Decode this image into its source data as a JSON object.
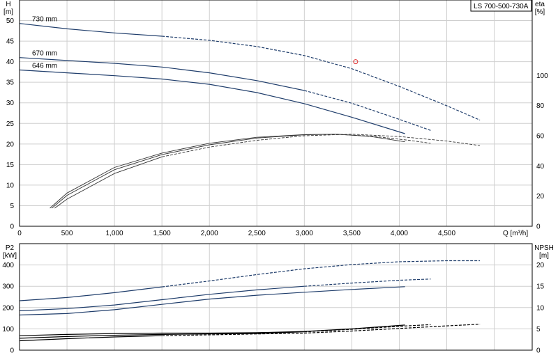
{
  "title": "LS 700-500-730A",
  "chart_data": [
    {
      "type": "line",
      "name": "upper",
      "ylabel_left": [
        "H",
        "[m]"
      ],
      "ylabel_right": [
        "eta",
        "[%]"
      ],
      "xlabel": "Q [m³/h]",
      "xlim": [
        0,
        5400
      ],
      "ylim_left": [
        0,
        55
      ],
      "ylim_right": [
        0,
        150
      ],
      "x_ticks": [
        0,
        500,
        1000,
        1500,
        2000,
        2500,
        3000,
        3500,
        4000,
        4500
      ],
      "x_tick_labels": [
        "0",
        "500",
        "1,000",
        "1,500",
        "2,000",
        "2,500",
        "3,000",
        "3,500",
        "4,000",
        "4,500"
      ],
      "y_ticks_left": [
        0,
        5,
        10,
        15,
        20,
        25,
        30,
        35,
        40,
        45,
        50
      ],
      "y_ticks_right": [
        0,
        20,
        40,
        60,
        80,
        100
      ],
      "x_grid": [
        0,
        500,
        1000,
        1500,
        2000,
        2500,
        3000,
        3500,
        4000,
        4500,
        5000
      ],
      "grid": true,
      "series": [
        {
          "name": "730 mm",
          "axis": "left",
          "color": "#1f3d6b",
          "solid_until": 1500,
          "x": [
            0,
            500,
            1000,
            1500,
            2000,
            2500,
            3000,
            3500,
            4000,
            4500,
            4850
          ],
          "y": [
            49.3,
            48.0,
            47.0,
            46.2,
            45.2,
            43.7,
            41.5,
            38.3,
            34.0,
            29.3,
            25.8
          ]
        },
        {
          "name": "670 mm",
          "axis": "left",
          "color": "#1f3d6b",
          "solid_until": 3000,
          "x": [
            0,
            500,
            1000,
            1500,
            2000,
            2500,
            3000,
            3500,
            4000,
            4330
          ],
          "y": [
            41.0,
            40.3,
            39.6,
            38.7,
            37.3,
            35.4,
            33.0,
            29.9,
            26.0,
            23.3
          ]
        },
        {
          "name": "646 mm",
          "axis": "left",
          "color": "#1f3d6b",
          "solid_until": 4060,
          "x": [
            0,
            500,
            1000,
            1500,
            2000,
            2500,
            3000,
            3500,
            4060
          ],
          "y": [
            38.0,
            37.3,
            36.6,
            35.8,
            34.5,
            32.5,
            29.8,
            26.5,
            22.5
          ]
        },
        {
          "name": "",
          "axis": "right",
          "color": "#333333",
          "solid_until": 4060,
          "x": [
            320,
            500,
            1000,
            1500,
            2000,
            2500,
            3000,
            3350,
            3700,
            4060
          ],
          "y": [
            12,
            22,
            39,
            48.5,
            55,
            59,
            60.8,
            61,
            59.5,
            56
          ]
        },
        {
          "name": "",
          "axis": "right",
          "color": "#333333",
          "solid_until": 3300,
          "x": [
            340,
            500,
            1000,
            1500,
            2000,
            2500,
            3000,
            3300,
            3700,
            4100,
            4330
          ],
          "y": [
            12,
            20.5,
            37.5,
            47.5,
            54,
            58.5,
            60.6,
            61,
            59.8,
            57,
            55
          ]
        },
        {
          "name": "",
          "axis": "right",
          "color": "#333333",
          "solid_until": 1500,
          "x": [
            370,
            500,
            1000,
            1500,
            2000,
            2500,
            3000,
            3500,
            4000,
            4500,
            4850
          ],
          "y": [
            12,
            18,
            35,
            46,
            52.5,
            57,
            60,
            61,
            59.5,
            56.5,
            53.5
          ]
        }
      ],
      "marker": {
        "type": "circle",
        "color": "#e03030",
        "x": 3540,
        "y": 40.0
      }
    },
    {
      "type": "line",
      "name": "lower",
      "ylabel_left": [
        "P2",
        "[kW]"
      ],
      "ylabel_right": [
        "NPSH",
        "[m]"
      ],
      "xlim": [
        0,
        5400
      ],
      "ylim_left": [
        0,
        500
      ],
      "ylim_right": [
        0,
        25
      ],
      "y_ticks_left": [
        0,
        100,
        200,
        300,
        400
      ],
      "y_ticks_right": [
        0,
        5,
        10,
        15,
        20
      ],
      "grid": true,
      "series": [
        {
          "name": "",
          "axis": "left",
          "color": "#1f3d6b",
          "solid_until": 1500,
          "x": [
            0,
            500,
            1000,
            1500,
            2000,
            2500,
            3000,
            3500,
            4000,
            4500,
            4850
          ],
          "y": [
            232,
            247,
            270,
            297,
            325,
            355,
            382,
            402,
            415,
            420,
            420
          ]
        },
        {
          "name": "",
          "axis": "left",
          "color": "#1f3d6b",
          "solid_until": 3000,
          "x": [
            0,
            500,
            1000,
            1500,
            2000,
            2500,
            3000,
            3500,
            4000,
            4330
          ],
          "y": [
            185,
            195,
            212,
            237,
            262,
            283,
            300,
            315,
            328,
            334
          ]
        },
        {
          "name": "",
          "axis": "left",
          "color": "#1f3d6b",
          "solid_until": 4060,
          "x": [
            0,
            500,
            1000,
            1500,
            2000,
            2500,
            3000,
            3500,
            4060
          ],
          "y": [
            165,
            172,
            190,
            215,
            240,
            258,
            272,
            285,
            298
          ]
        },
        {
          "name": "",
          "axis": "right",
          "color": "#000000",
          "solid_until": 4060,
          "x": [
            0,
            500,
            1000,
            1500,
            2000,
            2500,
            3000,
            3500,
            4060
          ],
          "y": [
            3.4,
            3.7,
            3.9,
            4.0,
            4.0,
            4.1,
            4.4,
            5.0,
            5.9
          ]
        },
        {
          "name": "",
          "axis": "right",
          "color": "#000000",
          "solid_until": 3000,
          "x": [
            0,
            500,
            1000,
            1500,
            2000,
            2500,
            3000,
            3500,
            4000,
            4330
          ],
          "y": [
            2.8,
            3.2,
            3.5,
            3.7,
            3.8,
            3.9,
            4.3,
            4.9,
            5.6,
            6.0
          ]
        },
        {
          "name": "",
          "axis": "right",
          "color": "#000000",
          "solid_until": 1500,
          "x": [
            0,
            500,
            1000,
            1500,
            2000,
            2500,
            3000,
            3500,
            4000,
            4500,
            4850
          ],
          "y": [
            2.2,
            2.7,
            3.1,
            3.4,
            3.6,
            3.8,
            4.0,
            4.5,
            5.1,
            5.7,
            6.1
          ]
        }
      ]
    }
  ]
}
